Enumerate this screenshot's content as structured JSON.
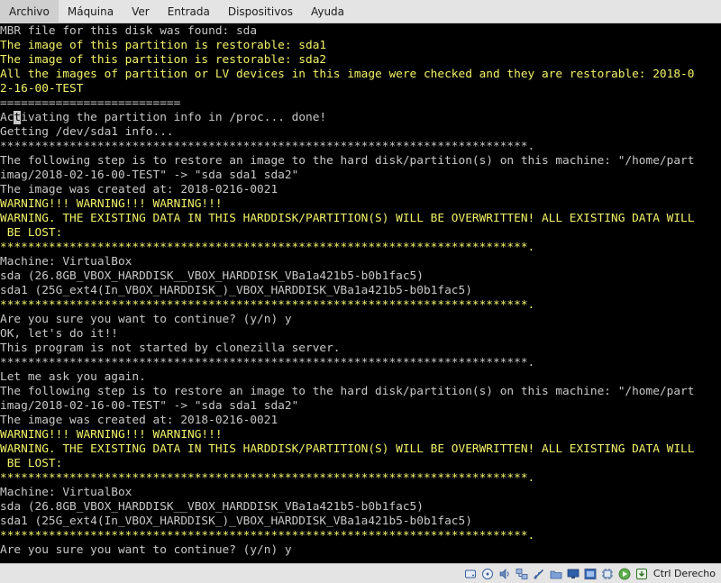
{
  "menubar": {
    "items": [
      "Archivo",
      "Máquina",
      "Ver",
      "Entrada",
      "Dispositivos",
      "Ayuda"
    ]
  },
  "terminal": {
    "colors": {
      "background": "#000000",
      "white": "#c8c8c8",
      "yellow": "#f2f26a"
    },
    "lines": [
      {
        "text": "MBR file for this disk was found: sda",
        "color": "white"
      },
      {
        "text": "The image of this partition is restorable: sda1",
        "color": "yellow"
      },
      {
        "text": "The image of this partition is restorable: sda2",
        "color": "yellow"
      },
      {
        "text": "All the images of partition or LV devices in this image were checked and they are restorable: 2018-0",
        "color": "yellow"
      },
      {
        "text": "2-16-00-TEST",
        "color": "yellow"
      },
      {
        "text": "==========================",
        "color": "white"
      },
      {
        "text": "Activating the partition info in /proc... done!",
        "color": "white"
      },
      {
        "text": "Getting /dev/sda1 info...",
        "color": "white"
      },
      {
        "text": "****************************************************************************.",
        "color": "white"
      },
      {
        "text": "The following step is to restore an image to the hard disk/partition(s) on this machine: \"/home/part",
        "color": "white"
      },
      {
        "text": "imag/2018-02-16-00-TEST\" -> \"sda sda1 sda2\"",
        "color": "white"
      },
      {
        "text": "The image was created at: 2018-0216-0021",
        "color": "white"
      },
      {
        "text": "WARNING!!! WARNING!!! WARNING!!!",
        "color": "yellow"
      },
      {
        "text": "WARNING. THE EXISTING DATA IN THIS HARDDISK/PARTITION(S) WILL BE OVERWRITTEN! ALL EXISTING DATA WILL",
        "color": "yellow"
      },
      {
        "text": " BE LOST:",
        "color": "yellow"
      },
      {
        "text": "****************************************************************************.",
        "color": "yellow"
      },
      {
        "text": "Machine: VirtualBox",
        "color": "white"
      },
      {
        "text": "sda (26.8GB_VBOX_HARDDISK__VBOX_HARDDISK_VBa1a421b5-b0b1fac5)",
        "color": "white"
      },
      {
        "text": "sda1 (25G_ext4(In_VBOX_HARDDISK_)_VBOX_HARDDISK_VBa1a421b5-b0b1fac5)",
        "color": "white"
      },
      {
        "text": "****************************************************************************.",
        "color": "yellow"
      },
      {
        "text": "Are you sure you want to continue? (y/n) y",
        "color": "white"
      },
      {
        "text": "OK, let's do it!!",
        "color": "white"
      },
      {
        "text": "This program is not started by clonezilla server.",
        "color": "white"
      },
      {
        "text": "****************************************************************************.",
        "color": "white"
      },
      {
        "text": "Let me ask you again.",
        "color": "white"
      },
      {
        "text": "The following step is to restore an image to the hard disk/partition(s) on this machine: \"/home/part",
        "color": "white"
      },
      {
        "text": "imag/2018-02-16-00-TEST\" -> \"sda sda1 sda2\"",
        "color": "white"
      },
      {
        "text": "The image was created at: 2018-0216-0021",
        "color": "white"
      },
      {
        "text": "WARNING!!! WARNING!!! WARNING!!!",
        "color": "yellow"
      },
      {
        "text": "WARNING. THE EXISTING DATA IN THIS HARDDISK/PARTITION(S) WILL BE OVERWRITTEN! ALL EXISTING DATA WILL",
        "color": "yellow"
      },
      {
        "text": " BE LOST:",
        "color": "yellow"
      },
      {
        "text": "****************************************************************************.",
        "color": "yellow"
      },
      {
        "text": "Machine: VirtualBox",
        "color": "white"
      },
      {
        "text": "sda (26.8GB_VBOX_HARDDISK__VBOX_HARDDISK_VBa1a421b5-b0b1fac5)",
        "color": "white"
      },
      {
        "text": "sda1 (25G_ext4(In_VBOX_HARDDISK_)_VBOX_HARDDISK_VBa1a421b5-b0b1fac5)",
        "color": "white"
      },
      {
        "text": "****************************************************************************.",
        "color": "yellow"
      },
      {
        "text": "Are you sure you want to continue? (y/n) y",
        "color": "white"
      }
    ]
  },
  "statusbar": {
    "icons": [
      "hard-disk-icon",
      "optical-drive-icon",
      "audio-icon",
      "network-icon",
      "usb-icon",
      "shared-folders-icon",
      "display-icon",
      "video-capture-icon",
      "cpu-icon",
      "mouse-integration-icon",
      "keyboard-capture-icon"
    ],
    "host_key": "Ctrl Derecho"
  }
}
